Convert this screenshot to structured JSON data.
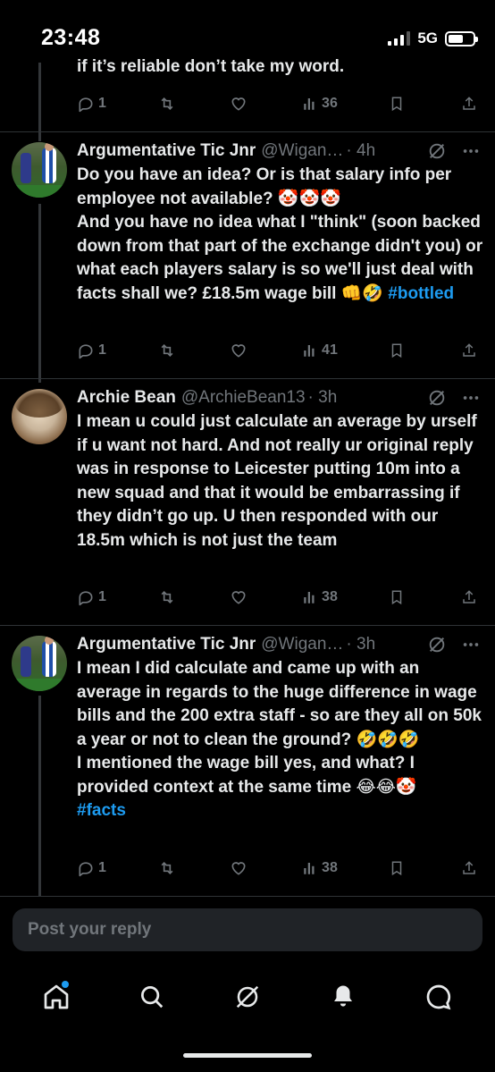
{
  "status_bar": {
    "time": "23:48",
    "network": "5G"
  },
  "top_fragment": "if it’s reliable don’t take my word.",
  "top_actions": {
    "replies": "1",
    "retweets": "",
    "likes": "",
    "views": "36"
  },
  "tweets": [
    {
      "author": "Argumentative Tic Jnr",
      "handle": "@Wigan…",
      "time": "· 4h",
      "text": "Do you have an idea? Or is that salary info per employee not available? 🤡🤡🤡\nAnd you have no idea what I \"think\" (soon backed down from that part of the exchange didn't you) or what each players salary is so we'll just deal with facts shall we? £18.5m wage bill 👊🤣 ",
      "hashtag": "#bottled",
      "replies": "1",
      "views": "41"
    },
    {
      "author": "Archie Bean",
      "handle": "@ArchieBean13",
      "time": "· 3h",
      "text": "I mean u could just calculate an average by urself if u want not hard. And not really ur original reply was in response to Leicester putting 10m into a new squad and that it would be embarrassing if they didn’t go up. U then responded with our 18.5m which is not just the team",
      "hashtag": "",
      "replies": "1",
      "views": "38"
    },
    {
      "author": "Argumentative Tic Jnr",
      "handle": "@Wigan…",
      "time": "· 3h",
      "text": "I mean I did calculate and came up with an average in regards to the huge difference in wage bills and the 200 extra staff - so are they all on 50k a year or not to clean the ground? 🤣🤣🤣\nI mentioned the wage bill yes, and what? I provided context at the same time 😂😂🤡\n",
      "hashtag": "#facts",
      "replies": "1",
      "views": "38"
    }
  ],
  "reply_box": {
    "placeholder": "Post your reply"
  },
  "nav": [
    "home-icon",
    "search-icon",
    "grok-icon",
    "notifications-icon",
    "messages-icon"
  ],
  "colors": {
    "background": "#000000",
    "text": "#e7e9ea",
    "muted": "#71767b",
    "accent": "#1d9bf0"
  }
}
